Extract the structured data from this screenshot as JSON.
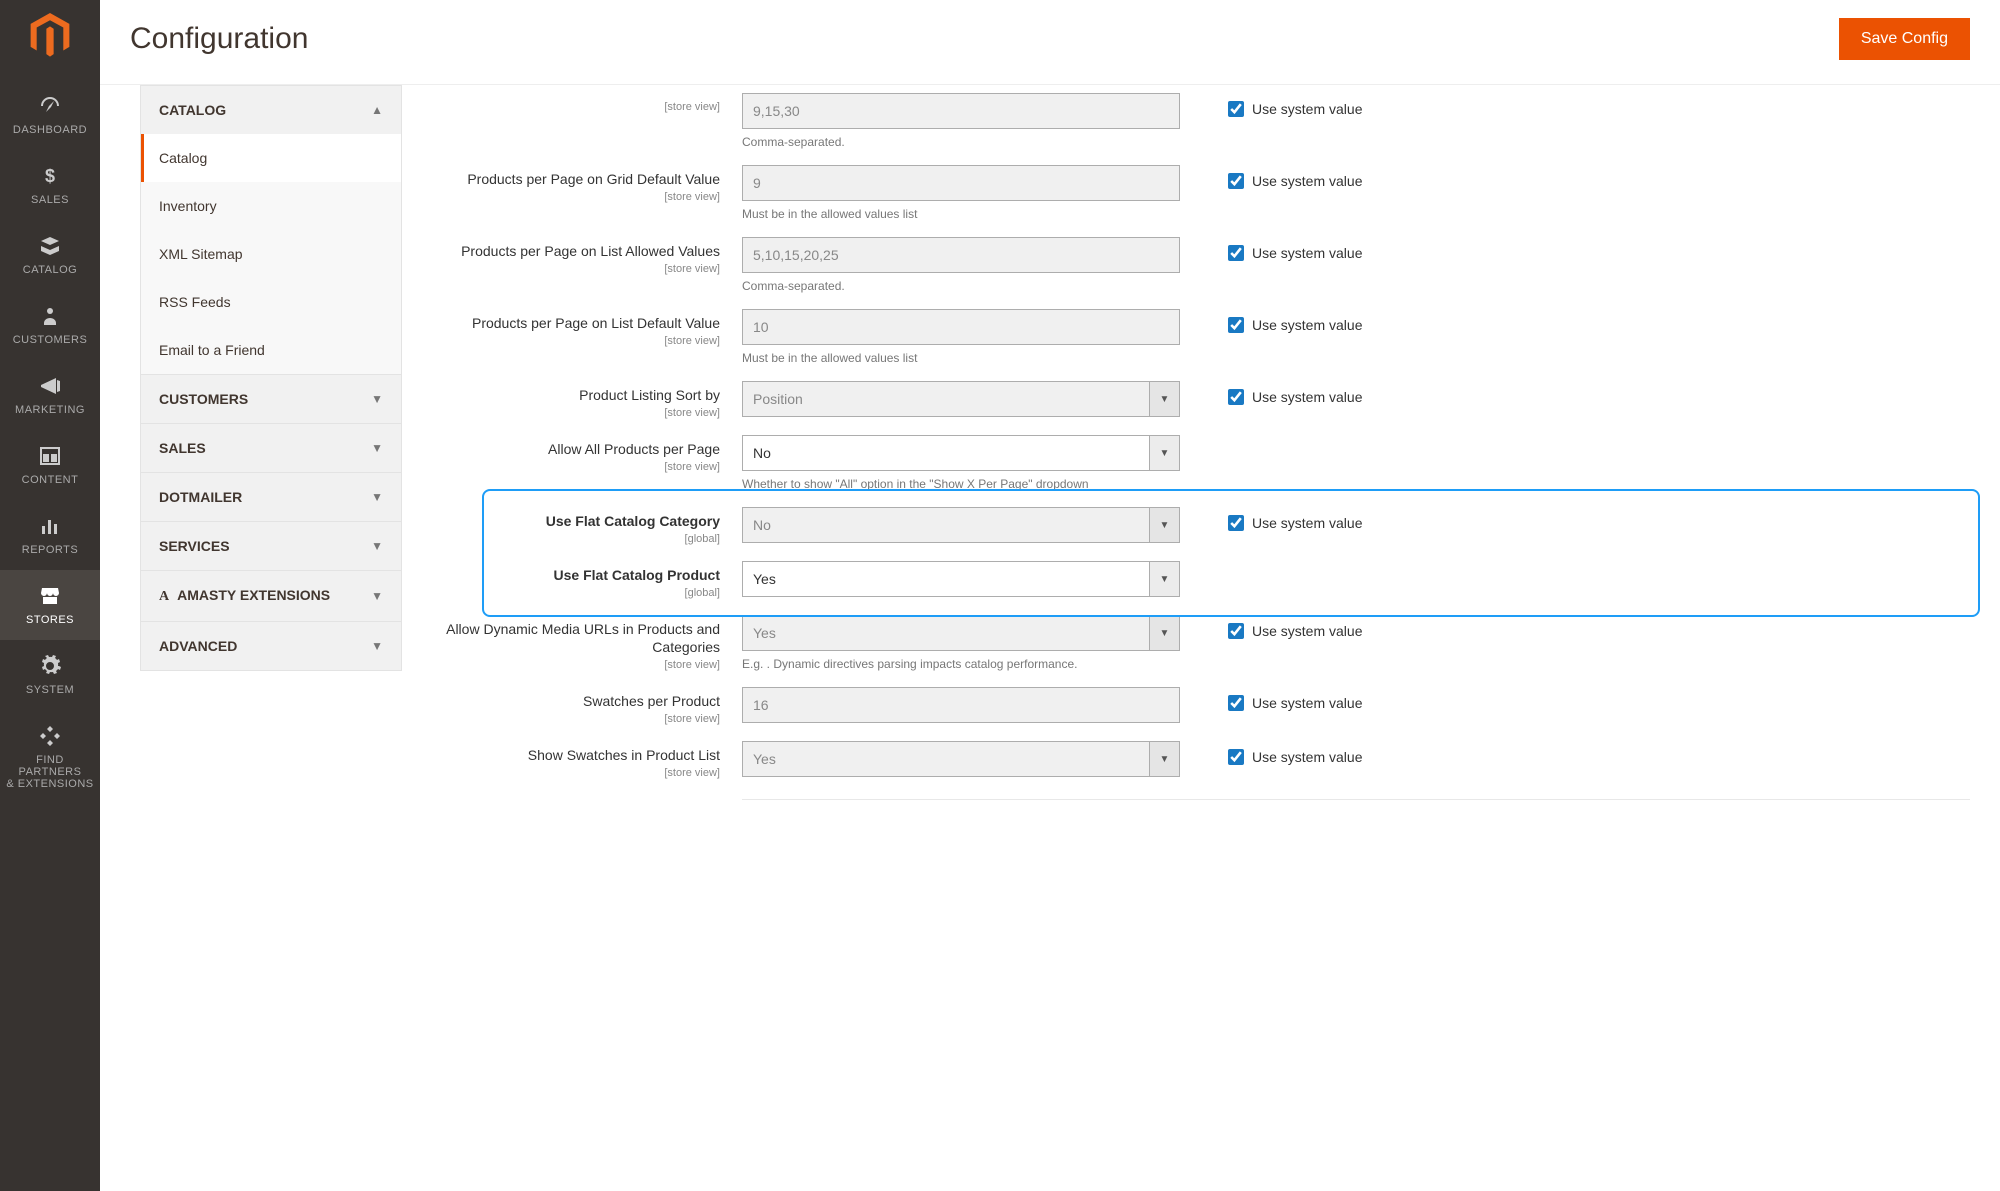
{
  "header": {
    "title": "Configuration",
    "save_btn": "Save Config"
  },
  "leftnav": {
    "items": [
      {
        "label": "DASHBOARD"
      },
      {
        "label": "SALES"
      },
      {
        "label": "CATALOG"
      },
      {
        "label": "CUSTOMERS"
      },
      {
        "label": "MARKETING"
      },
      {
        "label": "CONTENT"
      },
      {
        "label": "REPORTS"
      },
      {
        "label": "STORES"
      },
      {
        "label": "SYSTEM"
      },
      {
        "label": "FIND PARTNERS\n& EXTENSIONS"
      }
    ],
    "active_index": 7
  },
  "sidebar": {
    "sections": [
      {
        "title": "CATALOG",
        "expanded": true,
        "items": [
          "Catalog",
          "Inventory",
          "XML Sitemap",
          "RSS Feeds",
          "Email to a Friend"
        ],
        "active_item": 0
      },
      {
        "title": "CUSTOMERS"
      },
      {
        "title": "SALES"
      },
      {
        "title": "DOTMAILER"
      },
      {
        "title": "SERVICES"
      },
      {
        "title": "AMASTY EXTENSIONS",
        "icon": "A"
      },
      {
        "title": "ADVANCED"
      }
    ]
  },
  "fields": {
    "grid_allowed": {
      "value": "9,15,30",
      "scope": "[store view]",
      "help": "Comma-separated.",
      "use_sys": true
    },
    "grid_default": {
      "label": "Products per Page on Grid Default Value",
      "value": "9",
      "scope": "[store view]",
      "help": "Must be in the allowed values list",
      "use_sys": true
    },
    "list_allowed": {
      "label": "Products per Page on List Allowed Values",
      "value": "5,10,15,20,25",
      "scope": "[store view]",
      "help": "Comma-separated.",
      "use_sys": true
    },
    "list_default": {
      "label": "Products per Page on List Default Value",
      "value": "10",
      "scope": "[store view]",
      "help": "Must be in the allowed values list",
      "use_sys": true
    },
    "sort_by": {
      "label": "Product Listing Sort by",
      "value": "Position",
      "scope": "[store view]",
      "use_sys": true
    },
    "allow_all": {
      "label": "Allow All Products per Page",
      "value": "No",
      "scope": "[store view]",
      "help": "Whether to show \"All\" option in the \"Show X Per Page\" dropdown"
    },
    "flat_cat": {
      "label": "Use Flat Catalog Category",
      "value": "No",
      "scope": "[global]",
      "use_sys": true
    },
    "flat_prod": {
      "label": "Use Flat Catalog Product",
      "value": "Yes",
      "scope": "[global]"
    },
    "dyn_media": {
      "label": "Allow Dynamic Media URLs in Products and Categories",
      "value": "Yes",
      "scope": "[store view]",
      "help": "E.g. . Dynamic directives parsing impacts catalog performance.",
      "use_sys": true
    },
    "swatches": {
      "label": "Swatches per Product",
      "value": "16",
      "scope": "[store view]",
      "use_sys": true
    },
    "show_swatches": {
      "label": "Show Swatches in Product List",
      "value": "Yes",
      "scope": "[store view]",
      "use_sys": true
    }
  },
  "sys_label": "Use system value"
}
